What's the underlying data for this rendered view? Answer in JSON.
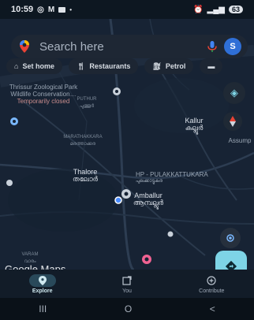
{
  "status_bar": {
    "time": "10:59",
    "left_icons": [
      "whatsapp-icon",
      "gmail-icon",
      "message-icon"
    ],
    "battery": "63"
  },
  "search": {
    "placeholder": "Search here",
    "avatar_letter": "S"
  },
  "chips": [
    {
      "label": "Set home",
      "icon": "home-icon"
    },
    {
      "label": "Restaurants",
      "icon": "restaurant-icon"
    },
    {
      "label": "Petrol",
      "icon": "fuel-icon"
    }
  ],
  "map_labels": {
    "zoo": [
      "Thrissur Zoological Park",
      "Wildlife Conservation…",
      "Temporarily closed"
    ],
    "puthur": [
      "PUTHUR",
      "പുത്തൂർ"
    ],
    "marathakkara": [
      "MARATHAKKARA",
      "മരത്താക്കര"
    ],
    "kallur": [
      "Kallur",
      "കല്ലൂർ"
    ],
    "assumption": "Assump",
    "thalore": [
      "Thalore",
      "തലോർ"
    ],
    "hp": [
      "HP - PULAKKATTUKARA",
      "പുലക്കാട്ടുകര"
    ],
    "amballur": [
      "Amballur",
      "ആമ്പല്ലൂർ"
    ],
    "varam": [
      "VARAM",
      "വാരം"
    ]
  },
  "watermark": "Google Maps",
  "bottom_nav": [
    {
      "label": "Explore",
      "icon": "explore-pin-icon",
      "active": true
    },
    {
      "label": "You",
      "icon": "saved-icon",
      "active": false
    },
    {
      "label": "Contribute",
      "icon": "contribute-icon",
      "active": false
    }
  ],
  "system_nav": {
    "recent": "III",
    "home": "O",
    "back": "<"
  },
  "colors": {
    "map_background": "#172334",
    "road": "#2d3d52",
    "accent_teal": "#7ed4e6",
    "location_blue": "#4a8cff"
  }
}
